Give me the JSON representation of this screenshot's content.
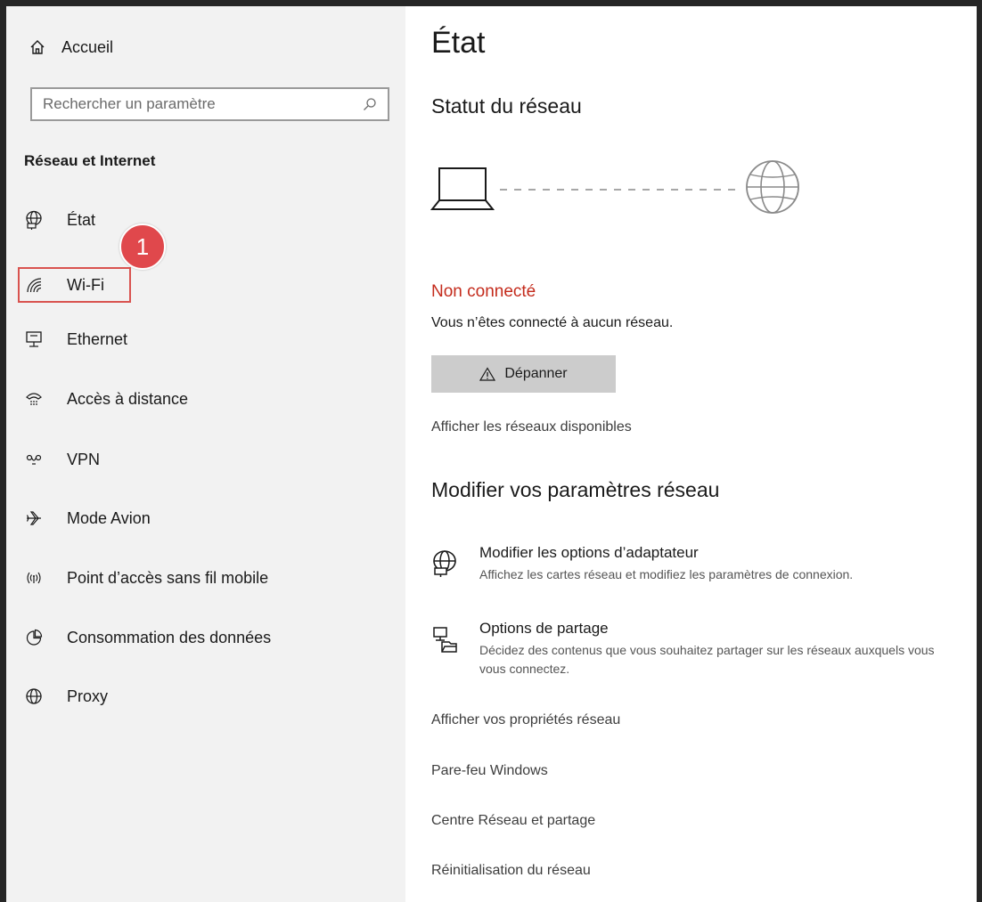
{
  "sidebar": {
    "home_label": "Accueil",
    "search_placeholder": "Rechercher un paramètre",
    "section_title": "Réseau et Internet",
    "items": [
      {
        "label": "État",
        "icon": "globe-network-icon"
      },
      {
        "label": "Wi-Fi",
        "icon": "wifi-icon"
      },
      {
        "label": "Ethernet",
        "icon": "ethernet-icon"
      },
      {
        "label": "Accès à distance",
        "icon": "dialup-icon"
      },
      {
        "label": "VPN",
        "icon": "vpn-icon"
      },
      {
        "label": "Mode Avion",
        "icon": "airplane-icon"
      },
      {
        "label": "Point d’accès sans fil mobile",
        "icon": "hotspot-icon"
      },
      {
        "label": "Consommation des données",
        "icon": "data-usage-icon"
      },
      {
        "label": "Proxy",
        "icon": "globe-icon"
      }
    ]
  },
  "annotation": {
    "step_number": "1",
    "color": "#e0484c"
  },
  "main": {
    "title": "État",
    "network_status_heading": "Statut du réseau",
    "status_title": "Non connecté",
    "status_color": "#c42b1c",
    "status_desc": "Vous n’êtes connecté à aucun réseau.",
    "troubleshoot_label": "Dépanner",
    "show_networks_link": "Afficher les réseaux disponibles",
    "change_settings_heading": "Modifier vos paramètres réseau",
    "options": [
      {
        "title": "Modifier les options d’adaptateur",
        "desc": "Affichez les cartes réseau et modifiez les paramètres de connexion."
      },
      {
        "title": "Options de partage",
        "desc": "Décidez des contenus que vous souhaitez partager sur les réseaux auxquels vous vous connectez."
      }
    ],
    "links": [
      "Afficher vos propriétés réseau",
      "Pare-feu Windows",
      "Centre Réseau et partage",
      "Réinitialisation du réseau"
    ]
  }
}
